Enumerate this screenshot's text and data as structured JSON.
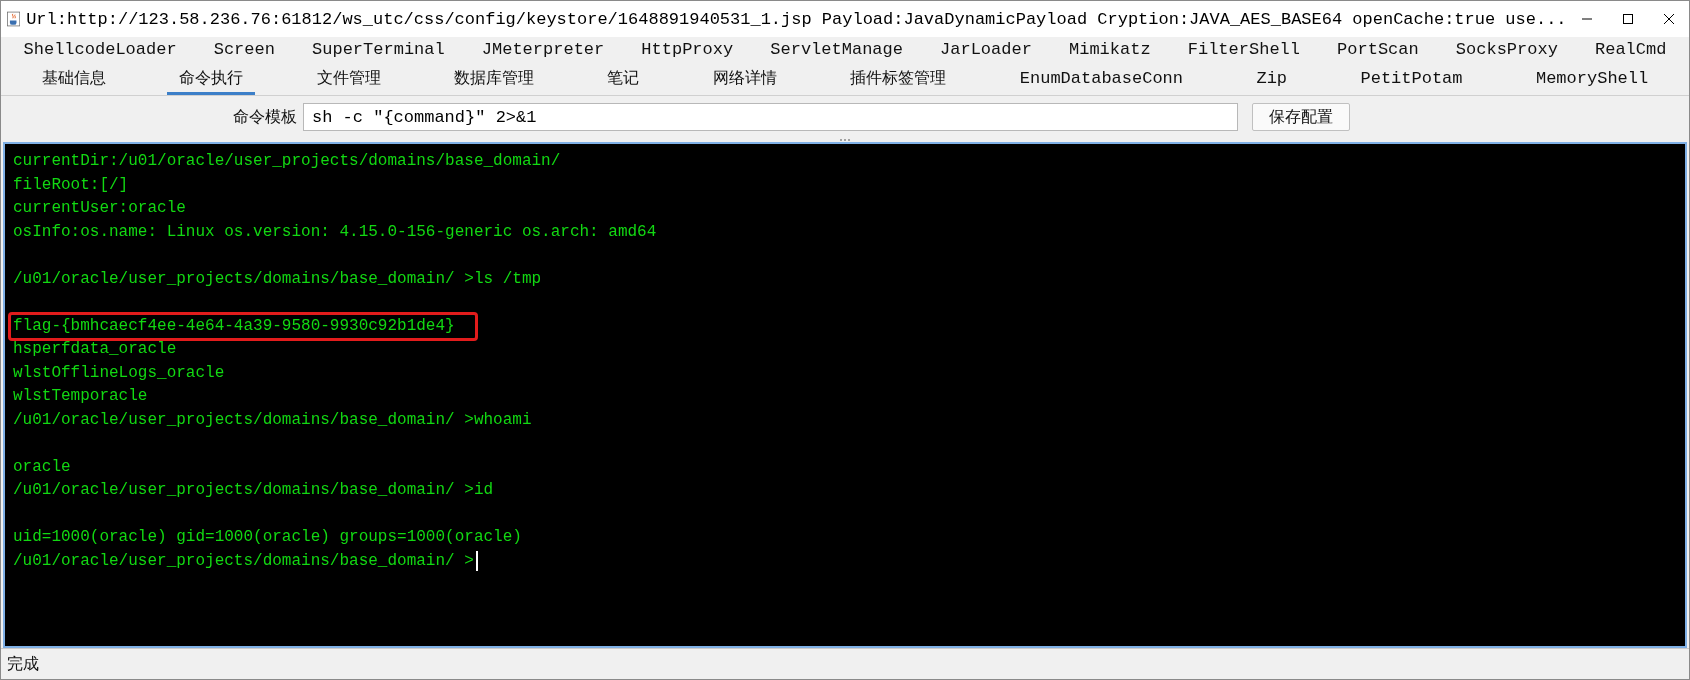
{
  "window": {
    "title": "Url:http://123.58.236.76:61812/ws_utc/css/config/keystore/1648891940531_1.jsp Payload:JavaDynamicPayload Cryption:JAVA_AES_BASE64 openCache:true use..."
  },
  "plugin_tabs": [
    {
      "label": "ShellcodeLoader",
      "selected": false
    },
    {
      "label": "Screen",
      "selected": false
    },
    {
      "label": "SuperTerminal",
      "selected": false
    },
    {
      "label": "JMeterpreter",
      "selected": false
    },
    {
      "label": "HttpProxy",
      "selected": false
    },
    {
      "label": "ServletManage",
      "selected": false
    },
    {
      "label": "JarLoader",
      "selected": false
    },
    {
      "label": "Mimikatz",
      "selected": false
    },
    {
      "label": "FilterShell",
      "selected": false
    },
    {
      "label": "PortScan",
      "selected": false
    },
    {
      "label": "SocksProxy",
      "selected": false
    },
    {
      "label": "RealCmd",
      "selected": false
    }
  ],
  "tabs": [
    {
      "label": "基础信息",
      "selected": false
    },
    {
      "label": "命令执行",
      "selected": true
    },
    {
      "label": "文件管理",
      "selected": false
    },
    {
      "label": "数据库管理",
      "selected": false
    },
    {
      "label": "笔记",
      "selected": false
    },
    {
      "label": "网络详情",
      "selected": false
    },
    {
      "label": "插件标签管理",
      "selected": false
    },
    {
      "label": "EnumDatabaseConn",
      "selected": false
    },
    {
      "label": "Zip",
      "selected": false
    },
    {
      "label": "PetitPotam",
      "selected": false
    },
    {
      "label": "MemoryShell",
      "selected": false
    }
  ],
  "command_template": {
    "label": "命令模板",
    "value": "sh -c \"{command}\" 2>&1",
    "button": "保存配置"
  },
  "terminal": {
    "cursor": true,
    "blocks": [
      [
        {
          "text": "currentDir:/u01/oracle/user_projects/domains/base_domain/",
          "highlighted": false
        },
        {
          "text": "fileRoot:[/]",
          "highlighted": false
        },
        {
          "text": "currentUser:oracle",
          "highlighted": false
        },
        {
          "text": "osInfo:os.name: Linux os.version: 4.15.0-156-generic os.arch: amd64",
          "highlighted": false
        }
      ],
      [
        {
          "text": "/u01/oracle/user_projects/domains/base_domain/ >ls /tmp",
          "highlighted": false
        }
      ],
      [
        {
          "text": "flag-{bmhcaecf4ee-4e64-4a39-9580-9930c92b1de4}",
          "highlighted": true
        },
        {
          "text": "hsperfdata_oracle",
          "highlighted": false
        },
        {
          "text": "wlstOfflineLogs_oracle",
          "highlighted": false
        },
        {
          "text": "wlstTemporacle",
          "highlighted": false
        },
        {
          "text": "/u01/oracle/user_projects/domains/base_domain/ >whoami",
          "highlighted": false
        }
      ],
      [
        {
          "text": "oracle",
          "highlighted": false
        },
        {
          "text": "/u01/oracle/user_projects/domains/base_domain/ >id",
          "highlighted": false
        }
      ],
      [
        {
          "text": "uid=1000(oracle) gid=1000(oracle) groups=1000(oracle)",
          "highlighted": false
        },
        {
          "text": "/u01/oracle/user_projects/domains/base_domain/ >",
          "highlighted": false
        }
      ]
    ]
  },
  "status_bar": {
    "text": "完成"
  }
}
